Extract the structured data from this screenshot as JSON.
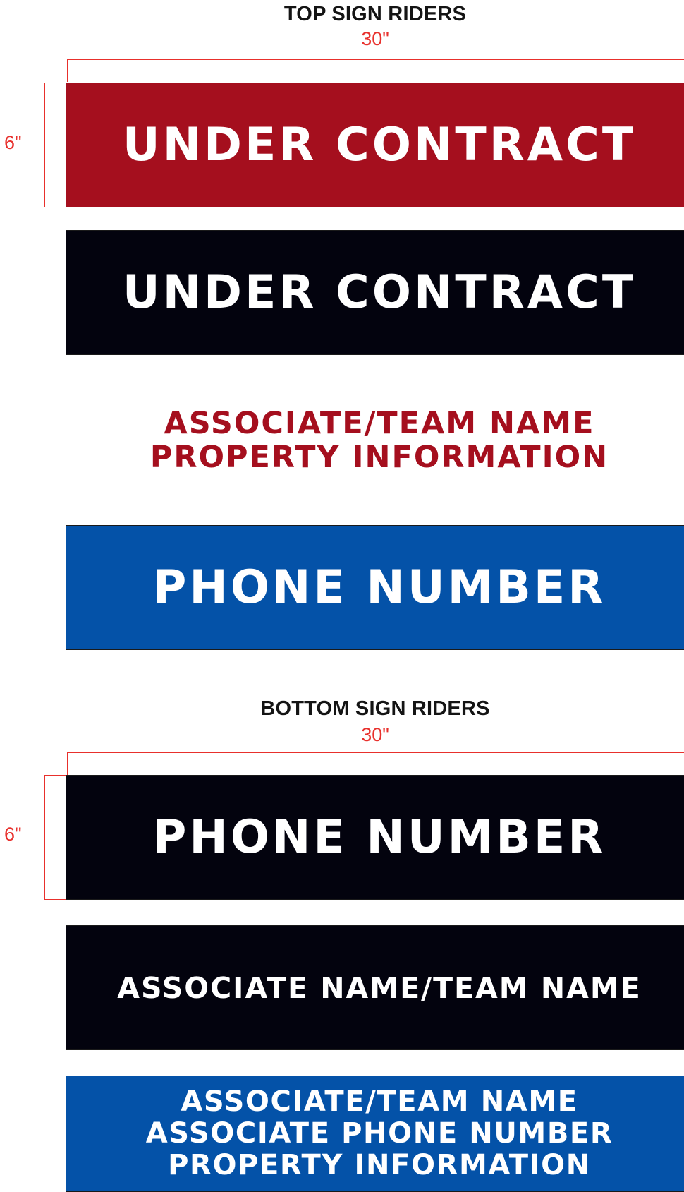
{
  "top_section": {
    "title": "TOP SIGN RIDERS",
    "width_label": "30\"",
    "height_label": "6\"",
    "riders": [
      {
        "lines": [
          "UNDER CONTRACT"
        ],
        "background": "#a50f1e",
        "text_color": "#ffffff"
      },
      {
        "lines": [
          "UNDER CONTRACT"
        ],
        "background": "#03030e",
        "text_color": "#ffffff"
      },
      {
        "lines": [
          "ASSOCIATE/TEAM NAME",
          "PROPERTY INFORMATION"
        ],
        "background": "#ffffff",
        "text_color": "#a50f1e"
      },
      {
        "lines": [
          "PHONE NUMBER"
        ],
        "background": "#0452a8",
        "text_color": "#ffffff"
      }
    ]
  },
  "bottom_section": {
    "title": "BOTTOM SIGN RIDERS",
    "width_label": "30\"",
    "height_label": "6\"",
    "riders": [
      {
        "lines": [
          "PHONE NUMBER"
        ],
        "background": "#03030e",
        "text_color": "#ffffff"
      },
      {
        "lines": [
          "ASSOCIATE NAME/TEAM NAME"
        ],
        "background": "#03030e",
        "text_color": "#ffffff"
      },
      {
        "lines": [
          "ASSOCIATE/TEAM NAME",
          "ASSOCIATE PHONE NUMBER",
          "PROPERTY INFORMATION"
        ],
        "background": "#0452a8",
        "text_color": "#ffffff"
      }
    ]
  },
  "colors": {
    "dimension_accent": "#e8302c"
  }
}
